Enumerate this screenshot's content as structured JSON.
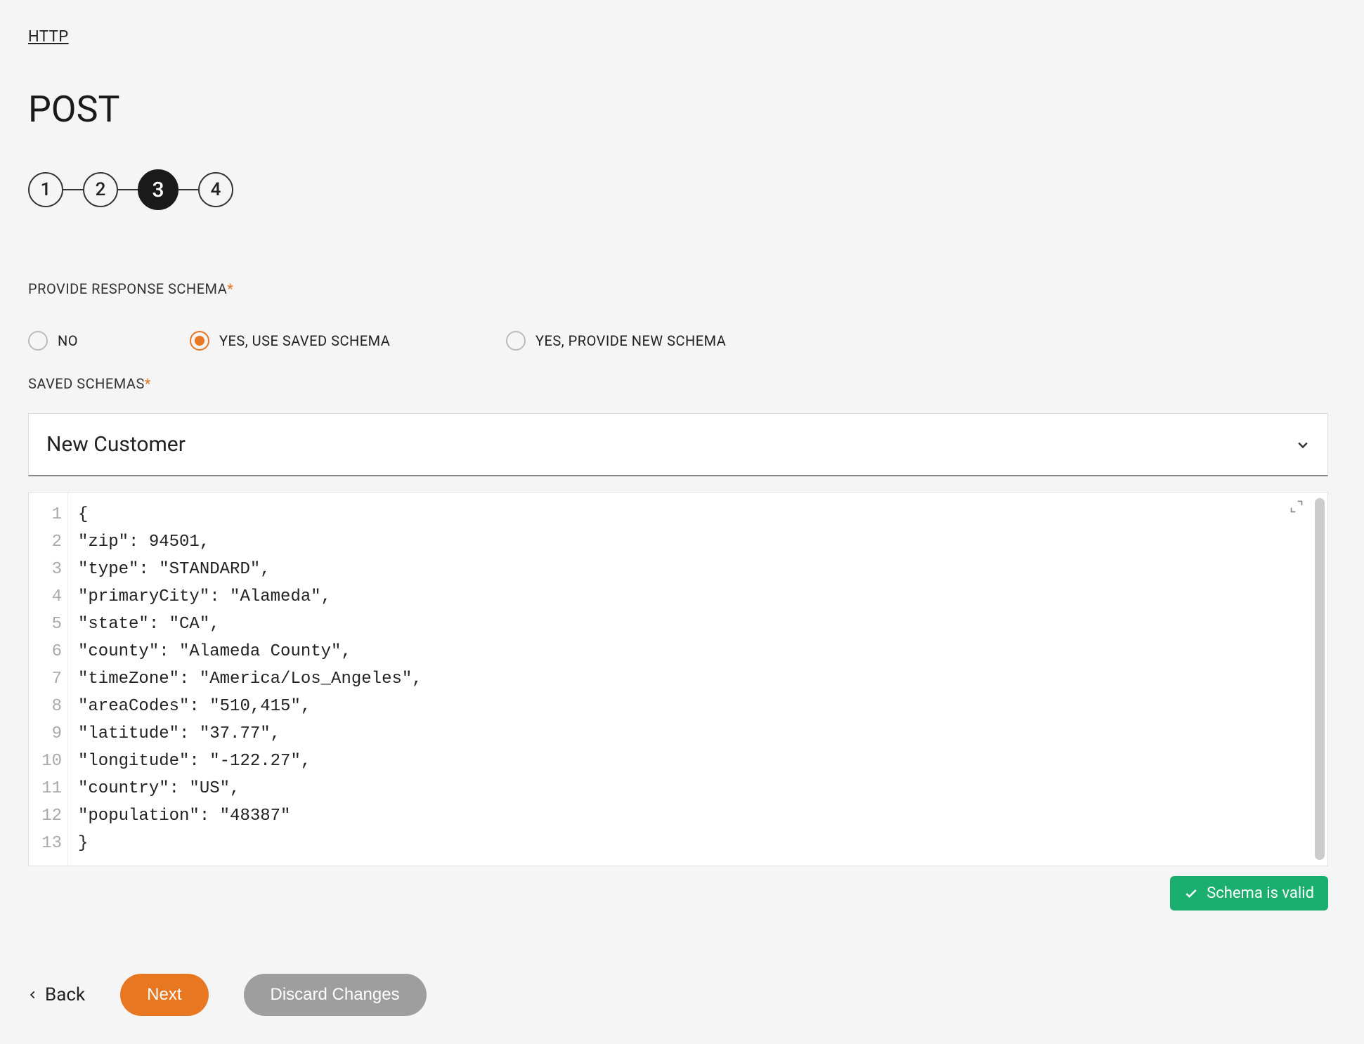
{
  "breadcrumb": "HTTP",
  "title": "POST",
  "steps": [
    "1",
    "2",
    "3",
    "4"
  ],
  "active_step_index": 2,
  "schema_label": "PROVIDE RESPONSE SCHEMA",
  "radio": {
    "no": "NO",
    "use_saved": "YES, USE SAVED SCHEMA",
    "new": "YES, PROVIDE NEW SCHEMA",
    "selected": "use_saved"
  },
  "saved_schemas_label": "SAVED SCHEMAS",
  "saved_schemas_value": "New Customer",
  "code_lines": [
    "{",
    "\"zip\": 94501,",
    "\"type\": \"STANDARD\",",
    "\"primaryCity\": \"Alameda\",",
    "\"state\": \"CA\",",
    "\"county\": \"Alameda County\",",
    "\"timeZone\": \"America/Los_Angeles\",",
    "\"areaCodes\": \"510,415\",",
    "\"latitude\": \"37.77\",",
    "\"longitude\": \"-122.27\",",
    "\"country\": \"US\",",
    "\"population\": \"48387\"",
    "}"
  ],
  "valid_text": "Schema is valid",
  "footer": {
    "back": "Back",
    "next": "Next",
    "discard": "Discard Changes"
  }
}
